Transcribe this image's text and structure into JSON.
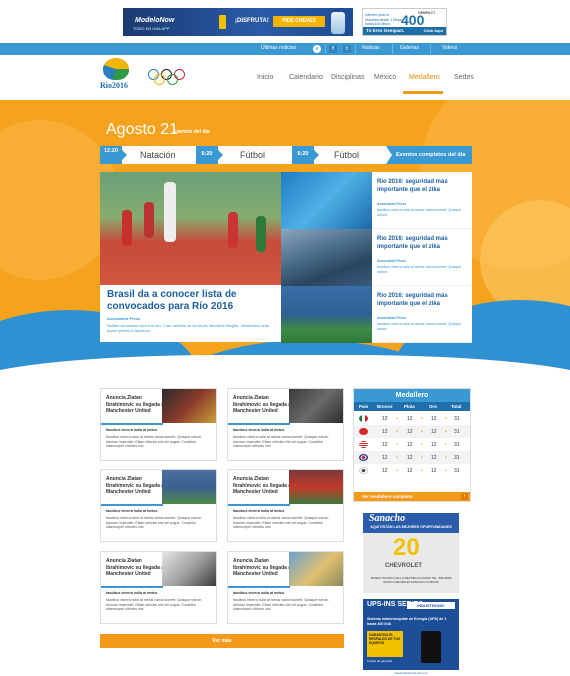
{
  "ads": {
    "top_left": {
      "brand": "ModeloNow",
      "brand_sub": "TODO EN UNA APP",
      "tag": "¡DISFRUTA!",
      "button": "PIDE CHEVES"
    },
    "top_right": {
      "text": "Internet para tu empresa desde 1 Mbps hasta 400 Mbps",
      "number": "400",
      "brand": "GEMPACT",
      "bar": "Tú Eres Gempact.",
      "cta": "Click Aquí"
    },
    "side1": {
      "brand": "Sanacho",
      "line": "AQUÍ ESTÁN LAS MEJORES OPORTUNIDADES",
      "number": "20",
      "brand2": "CHEVROLET",
      "address": "PASEO TRUJIPO DE LA REPÚBLICA #2000 TEL. 586-5999 WWW.CHEVROLETSANACHO.COM.MX"
    },
    "side2": {
      "brand": "UPS-INS SERIES",
      "partner": "INDUSTRONIC",
      "headline": "Sistema Ininterrumpible de Energía (UPS) de 1 hasta 400 kVA",
      "box": "GARANTIZA EL RESPALDO DE TUS EQUIPOS",
      "guarantee": "3 años de garantía",
      "footer": "www.industronic.com.mx"
    }
  },
  "topbar": {
    "search": "Últimas noticias",
    "fb": "f",
    "tw": "t",
    "noticias": "Noticias",
    "galerias": "Galerías",
    "videos": "Videos"
  },
  "header": {
    "logo_text": "Rio2016",
    "nav": [
      "Inicio",
      "Calendario",
      "Disciplinas",
      "México",
      "Medallero",
      "Sedes"
    ],
    "active": "Medallero"
  },
  "hero": {
    "date": "Agosto 21",
    "events_label": "Eventos del día",
    "tabs": [
      {
        "time": "12:20",
        "sport": "Natación"
      },
      {
        "time": "6:20",
        "sport": "Fútbol"
      },
      {
        "time": "6:20",
        "sport": "Fútbol"
      }
    ],
    "all_events": "Eventos completos del día",
    "main": {
      "title": "Brasil da a conocer lista de convocados para Río 2016",
      "source": "Associated Press",
      "text": "Nullam accumsan lorem in dui. Cras ultricies mi eu turpis hendrerit fringilla. Vestibulum ante ipsum primis in faucibus."
    },
    "side": [
      {
        "title": "Río 2016: seguridad más importante que el zika",
        "source": "Associated Press",
        "text": "faucibus viverra nulla at metus varius laoreet. Quisque rutrum."
      },
      {
        "title": "Río 2016: seguridad más importante que el zika",
        "source": "Associated Press",
        "text": "faucibus viverra nulla at metus varius laoreet. Quisque rutrum."
      },
      {
        "title": "Río 2016: seguridad más importante que el zika",
        "source": "Associated Press",
        "text": "faucibus viverra nulla at metus varius laoreet. Quisque rutrum."
      }
    ]
  },
  "cards": [
    {
      "title": "Anuncia Zlatan Ibrahimovic su llegada al Manchester United",
      "source": "faucibus viverra nulla at metus",
      "text": "faucibus viverra nulla at metus varius laoreet. Quisque rutrum. Aenean imperdiet. Etiam ultricies nisi vel augue. Curabitur ullamcorper ultricies nisi."
    },
    {
      "title": "Anuncia Zlatan Ibrahimovic su llegada al Manchester United",
      "source": "faucibus viverra nulla at metus",
      "text": "faucibus viverra nulla at metus varius laoreet. Quisque rutrum. Aenean imperdiet. Etiam ultricies nisi vel augue. Curabitur ullamcorper ultricies nisi."
    },
    {
      "title": "Anuncia Zlatan Ibrahimovic su llegada al Manchester United",
      "source": "faucibus viverra nulla at metus",
      "text": "faucibus viverra nulla at metus varius laoreet. Quisque rutrum. Aenean imperdiet. Etiam ultricies nisi vel augue. Curabitur ullamcorper ultricies nisi."
    },
    {
      "title": "Anuncia Zlatan Ibrahimovic su llegada al Manchester United",
      "source": "faucibus viverra nulla at metus",
      "text": "faucibus viverra nulla at metus varius laoreet. Quisque rutrum. Aenean imperdiet. Etiam ultricies nisi vel augue. Curabitur ullamcorper ultricies nisi."
    },
    {
      "title": "Anuncia Zlatan Ibrahimovic su llegada al Manchester United",
      "source": "faucibus viverra nulla at metus",
      "text": "faucibus viverra nulla at metus varius laoreet. Quisque rutrum. Aenean imperdiet. Etiam ultricies nisi vel augue. Curabitur ullamcorper ultricies nisi."
    },
    {
      "title": "Anuncia Zlatan Ibrahimovic su llegada al Manchester United",
      "source": "faucibus viverra nulla at metus",
      "text": "faucibus viverra nulla at metus varius laoreet. Quisque rutrum. Aenean imperdiet. Etiam ultricies nisi vel augue. Curabitur ullamcorper ultricies nisi."
    }
  ],
  "more_button": "Ver más",
  "medal_table": {
    "title": "Medallero",
    "headers": [
      "País",
      "Bronce",
      "Plata",
      "Oro",
      "Total"
    ],
    "rows": [
      {
        "flag": "Mexico",
        "bronce": "12",
        "plata": "12",
        "oro": "12",
        "total": "31"
      },
      {
        "flag": "China",
        "bronce": "12",
        "plata": "12",
        "oro": "12",
        "total": "31"
      },
      {
        "flag": "USA",
        "bronce": "12",
        "plata": "12",
        "oro": "12",
        "total": "31"
      },
      {
        "flag": "UK",
        "bronce": "12",
        "plata": "12",
        "oro": "12",
        "total": "31"
      },
      {
        "flag": "Korea",
        "bronce": "12",
        "plata": "12",
        "oro": "12",
        "total": "31"
      }
    ],
    "more": "Ver medallero completo",
    "more_arrow": "›"
  },
  "colors": {
    "accent_blue": "#3a98d3",
    "accent_orange": "#f39a1a",
    "headline_blue": "#1a5fa0"
  }
}
